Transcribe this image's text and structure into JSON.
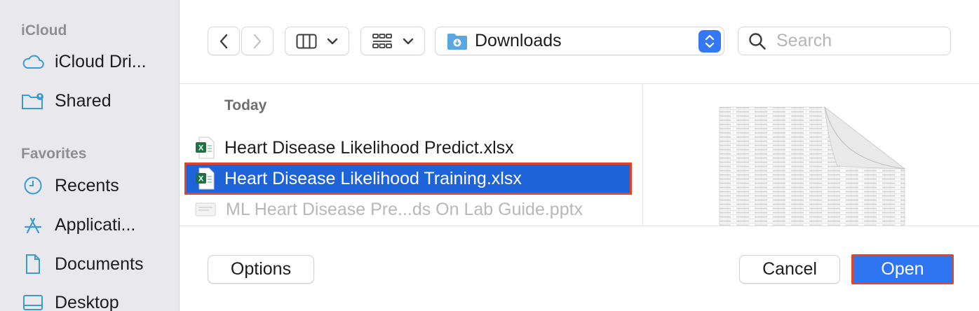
{
  "sidebar": {
    "sections": [
      {
        "title": "iCloud",
        "items": [
          {
            "label": "iCloud Dri...",
            "icon": "cloud-icon"
          },
          {
            "label": "Shared",
            "icon": "shared-folder-icon"
          }
        ]
      },
      {
        "title": "Favorites",
        "items": [
          {
            "label": "Recents",
            "icon": "clock-icon"
          },
          {
            "label": "Applicati...",
            "icon": "applications-icon"
          },
          {
            "label": "Documents",
            "icon": "document-icon"
          },
          {
            "label": "Desktop",
            "icon": "desktop-icon"
          }
        ]
      }
    ]
  },
  "toolbar": {
    "location": "Downloads",
    "search_placeholder": "Search"
  },
  "filelist": {
    "group": "Today",
    "files": [
      {
        "name": "Heart Disease Likelihood Predict.xlsx",
        "icon": "excel-file-icon",
        "state": "normal"
      },
      {
        "name": "Heart Disease Likelihood Training.xlsx",
        "icon": "excel-file-icon",
        "state": "selected"
      },
      {
        "name": "ML Heart Disease Pre...ds On Lab Guide.pptx",
        "icon": "pptx-file-icon",
        "state": "disabled"
      }
    ]
  },
  "buttons": {
    "options": "Options",
    "cancel": "Cancel",
    "open": "Open"
  },
  "colors": {
    "accent": "#2f74f0",
    "selection": "#1f63d9",
    "highlight_outline": "#e0452a",
    "excel_green": "#1e7145"
  }
}
